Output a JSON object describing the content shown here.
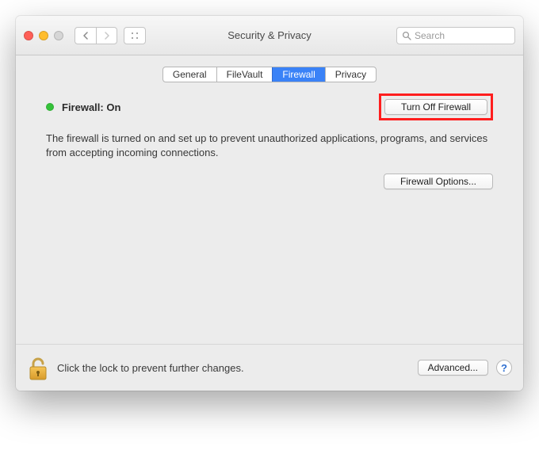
{
  "window": {
    "title": "Security & Privacy"
  },
  "search": {
    "placeholder": "Search"
  },
  "tabs": {
    "general": "General",
    "filevault": "FileVault",
    "firewall": "Firewall",
    "privacy": "Privacy"
  },
  "firewall": {
    "status_label": "Firewall: On",
    "turn_off_label": "Turn Off Firewall",
    "description": "The firewall is turned on and set up to prevent unauthorized applications, programs, and services from accepting incoming connections.",
    "options_label": "Firewall Options..."
  },
  "footer": {
    "lock_text": "Click the lock to prevent further changes.",
    "advanced_label": "Advanced...",
    "help_label": "?"
  }
}
